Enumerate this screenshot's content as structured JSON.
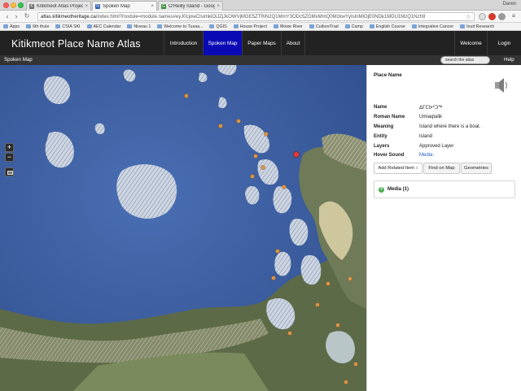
{
  "browser": {
    "tabs": [
      {
        "title": "Kitikmeot Atlas Project",
        "favicon": "K",
        "favicon_color": "#6b6b6b"
      },
      {
        "title": "Spoken Map",
        "favicon": "N",
        "favicon_color": "#2b5fb3"
      },
      {
        "title": "O'Reilly Island - Google M",
        "favicon": "G",
        "favicon_color": "#3b8c3b"
      }
    ],
    "profile": "Daren",
    "url_host": "atlas.kitikmeotheritage.ca",
    "url_path": "/index.html?module=module.names#eyJ0cjoieClsimkiOiJZjJkOWVjMGE5ZTRiN2Q1MmY3ODc5ZGMxMmQ0MzkwYyIsInMiOjE0NDk1MDU1MzQ1Nzh9",
    "bookmarks": [
      "Apps",
      "6th thule",
      "CSIA SKI",
      "AEC Calendar",
      "Niveau 1",
      "Welcome to Tusaa...",
      "QGIS",
      "House Project",
      "Moise River",
      "CultureTrad",
      "Camp",
      "English Course",
      "Integrative Cancer",
      "Inuit Research"
    ]
  },
  "header": {
    "title": "Kitikmeot Place Name Atlas",
    "nav": [
      "Introduction",
      "Spoken Map",
      "Paper Maps",
      "About"
    ],
    "welcome": "Welcome",
    "login": "Login"
  },
  "subbar": {
    "breadcrumb": "Spoken Map",
    "search_placeholder": "search the atlas",
    "help": "Help"
  },
  "map": {
    "zoom_in": "+",
    "zoom_out": "−"
  },
  "panel": {
    "title": "Place Name",
    "rows": [
      {
        "label": "Name",
        "value": "ᐃᒥᑕᐅᑦᑐᖅ"
      },
      {
        "label": "Roman Name",
        "value": "Umiaqtalik"
      },
      {
        "label": "Meaning",
        "value": "Island where there is a boat."
      },
      {
        "label": "Entity",
        "value": "Island"
      },
      {
        "label": "Layers",
        "value": "Approved Layer"
      },
      {
        "label": "Hover Sound",
        "value": "Media:"
      }
    ],
    "buttons": {
      "related": "Add Related Item ↕",
      "find": "Find on Map",
      "geometries": "Geometries"
    },
    "media": "Media (1)"
  },
  "colors": {
    "header_bg": "#222222",
    "nav_active": "#0a0ab4",
    "link": "#1b5fc1",
    "media_plus": "#4caf50",
    "place_marker": "#d9954a",
    "selected_marker": "#e03c3c"
  }
}
